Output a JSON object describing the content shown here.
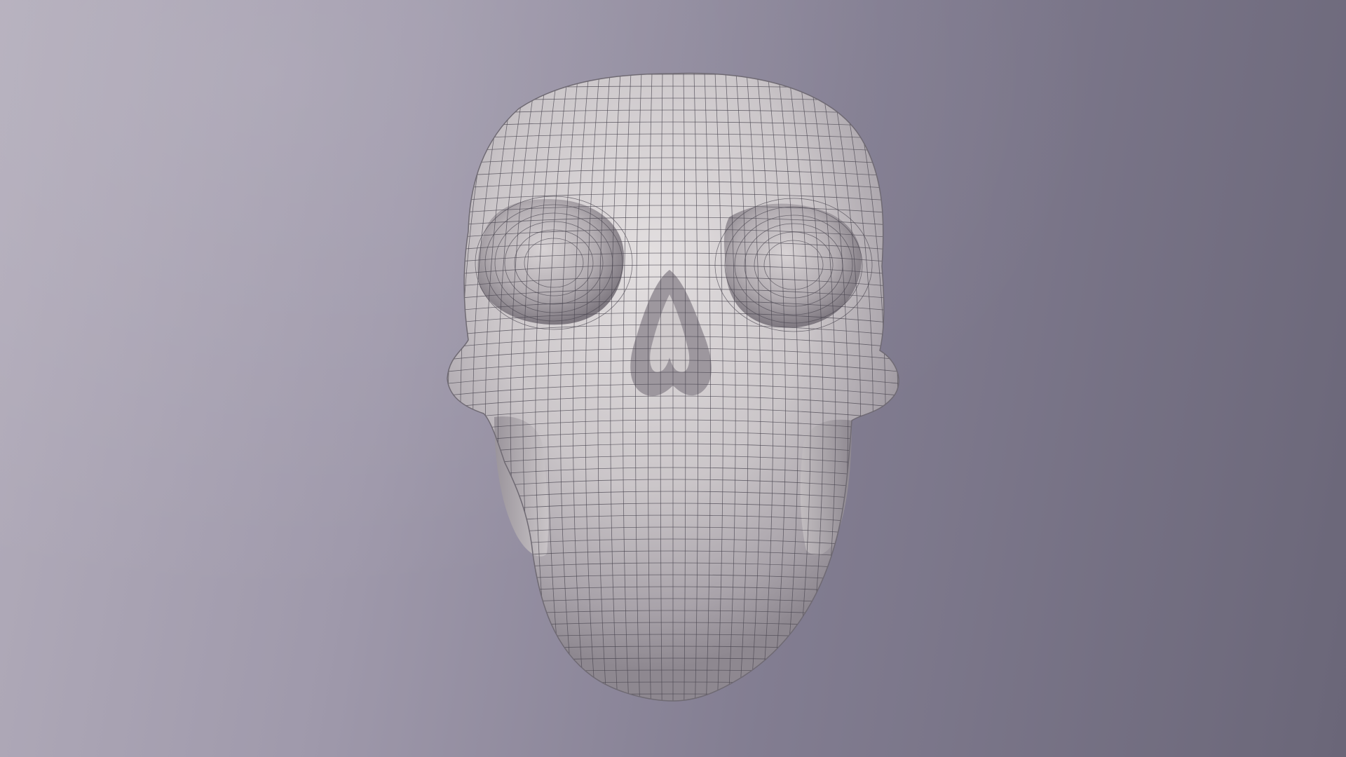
{
  "viewport": {
    "model": "skull-wireframe-mesh",
    "shading": "matcap-grey-with-wireframe",
    "colors": {
      "bg_left": "#b3adbb",
      "bg_right": "#6a6678",
      "mesh_fill": "#d2cdcf",
      "mesh_shadow": "#8e8890",
      "wire": "#4a4650"
    }
  }
}
